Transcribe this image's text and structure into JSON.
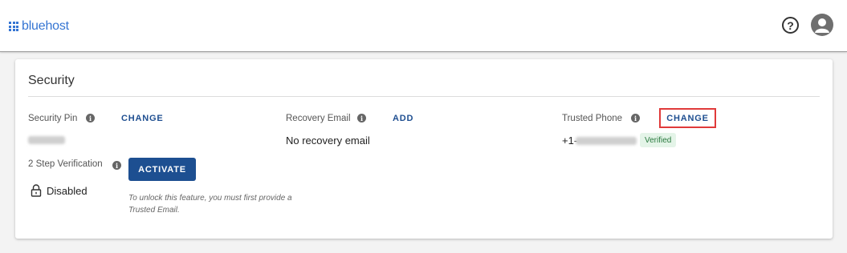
{
  "header": {
    "logo_text": "bluehost",
    "help_label": "?",
    "accent_color": "#3575d3"
  },
  "security": {
    "title": "Security",
    "pin": {
      "label": "Security Pin",
      "action": "CHANGE",
      "value_hidden": true
    },
    "recovery_email": {
      "label": "Recovery Email",
      "action": "ADD",
      "value": "No recovery email"
    },
    "trusted_phone": {
      "label": "Trusted Phone",
      "action": "CHANGE",
      "value_prefix": "+1-",
      "badge": "Verified",
      "highlight_color": "#e03a3a"
    },
    "two_step": {
      "label": "2 Step Verification",
      "action": "ACTIVATE",
      "status": "Disabled",
      "hint": "To unlock this feature, you must first provide a Trusted Email."
    }
  },
  "icons": {
    "info": "info-icon",
    "lock": "lock-icon",
    "help": "help-icon",
    "avatar": "user-avatar-icon",
    "logo": "grid-logo-icon"
  },
  "colors": {
    "button_blue": "#1d4f91",
    "link_blue": "#1f4f91",
    "verified_bg": "#e4f4e8",
    "verified_text": "#2a7a3f"
  }
}
